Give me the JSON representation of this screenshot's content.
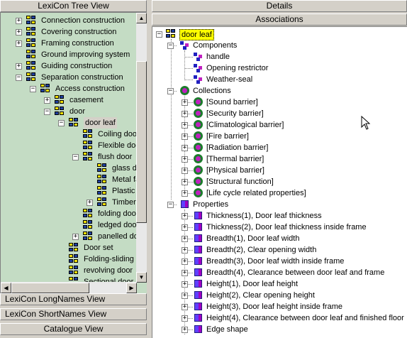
{
  "left_panel": {
    "title": "LexiCon Tree View",
    "tree": [
      {
        "label": "Connection construction",
        "level": 0,
        "expander": "+"
      },
      {
        "label": "Covering construction",
        "level": 0,
        "expander": "+"
      },
      {
        "label": "Framing construction",
        "level": 0,
        "expander": "+"
      },
      {
        "label": "Ground improving system",
        "level": 0,
        "expander": ""
      },
      {
        "label": "Guiding construction",
        "level": 0,
        "expander": "+"
      },
      {
        "label": "Separation construction",
        "level": 0,
        "expander": "-"
      },
      {
        "label": "Access construction",
        "level": 1,
        "expander": "-"
      },
      {
        "label": "casement",
        "level": 2,
        "expander": "+"
      },
      {
        "label": "door",
        "level": 2,
        "expander": "-"
      },
      {
        "label": "door leaf",
        "level": 3,
        "expander": "-",
        "selected": true
      },
      {
        "label": "Coiling door",
        "level": 4,
        "expander": ""
      },
      {
        "label": "Flexible door",
        "level": 4,
        "expander": ""
      },
      {
        "label": "flush door",
        "level": 4,
        "expander": "-"
      },
      {
        "label": "glass door",
        "level": 5,
        "expander": ""
      },
      {
        "label": "Metal faced door",
        "level": 5,
        "expander": ""
      },
      {
        "label": "Plastic faced door",
        "level": 5,
        "expander": ""
      },
      {
        "label": "Timber faced door",
        "level": 5,
        "expander": "+"
      },
      {
        "label": "folding door",
        "level": 4,
        "expander": ""
      },
      {
        "label": "ledged door",
        "level": 4,
        "expander": ""
      },
      {
        "label": "panelled door",
        "level": 4,
        "expander": "+"
      },
      {
        "label": "Door set",
        "level": 3,
        "expander": ""
      },
      {
        "label": "Folding-sliding door",
        "level": 3,
        "expander": ""
      },
      {
        "label": "revolving door",
        "level": 3,
        "expander": ""
      },
      {
        "label": "Sectional door",
        "level": 3,
        "expander": ""
      }
    ],
    "bottom_bars": [
      "LexiCon LongNames View",
      "LexiCon ShortNames View",
      "Catalogue View"
    ]
  },
  "right_panel": {
    "details_title": "Details",
    "associations_title": "Associations",
    "root": "door leaf",
    "components_label": "Components",
    "components": [
      "handle",
      "Opening restrictor",
      "Weather-seal"
    ],
    "collections_label": "Collections",
    "collections": [
      "[Sound barrier]",
      "[Security barrier]",
      "[Climatological barrier]",
      "[Fire barrier]",
      "[Radiation barrier]",
      "[Thermal barrier]",
      "[Physical barrier]",
      "[Structural function]",
      "[Life cycle related properties]"
    ],
    "properties_label": "Properties",
    "properties": [
      "Thickness(1), Door leaf thickness",
      "Thickness(2), Door leaf thickness inside frame",
      "Breadth(1), Door leaf width",
      "Breadth(2), Clear opening width",
      "Breadth(3), Door leaf width inside frame",
      "Breadth(4), Clearance between door leaf and frame",
      "Height(1), Door leaf height",
      "Height(2), Clear opening height",
      "Height(3), Door leaf height inside frame",
      "Height(4), Clearance between door leaf and finished floor",
      "Edge shape"
    ]
  },
  "colors": {
    "tree_bg": "#c4dcc4",
    "selected_highlight": "#ffff00",
    "collection_icon": "#1c7c2c",
    "property_icon": "#a000c0"
  }
}
